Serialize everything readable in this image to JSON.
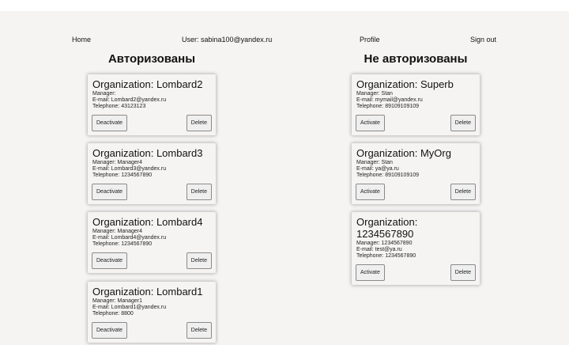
{
  "nav": {
    "home": "Home",
    "user": "User: sabina100@yandex.ru",
    "profile": "Profile",
    "signout": "Sign out"
  },
  "columns": {
    "authorized_title": "Авторизованы",
    "unauthorized_title": "Не авторизованы"
  },
  "labels": {
    "organization": "Organization: ",
    "manager": "Manager: ",
    "email": "E-mail: ",
    "telephone": "Telephone: ",
    "deactivate": "Deactivate",
    "activate": "Activate",
    "delete": "Delete"
  },
  "authorized": [
    {
      "name": "Lombard2",
      "manager": "",
      "email": "Lombard2@yandex.ru",
      "telephone": "43123123"
    },
    {
      "name": "Lombard3",
      "manager": "Manager4",
      "email": "Lombard3@yandex.ru",
      "telephone": "1234567890"
    },
    {
      "name": "Lombard4",
      "manager": "Manager4",
      "email": "Lombard4@yandex.ru",
      "telephone": "1234567890"
    },
    {
      "name": "Lombard1",
      "manager": "Manager1",
      "email": "Lombard1@yandex.ru",
      "telephone": "8800"
    }
  ],
  "unauthorized": [
    {
      "name": "Superb",
      "manager": "Stan",
      "email": "mymail@yandex.ru",
      "telephone": "89109109109"
    },
    {
      "name": "MyOrg",
      "manager": "Stan",
      "email": "ya@ya.ru",
      "telephone": "89109109109"
    },
    {
      "name": "1234567890",
      "manager": "1234567890",
      "email": "test@ya.ru",
      "telephone": "1234567890"
    }
  ]
}
